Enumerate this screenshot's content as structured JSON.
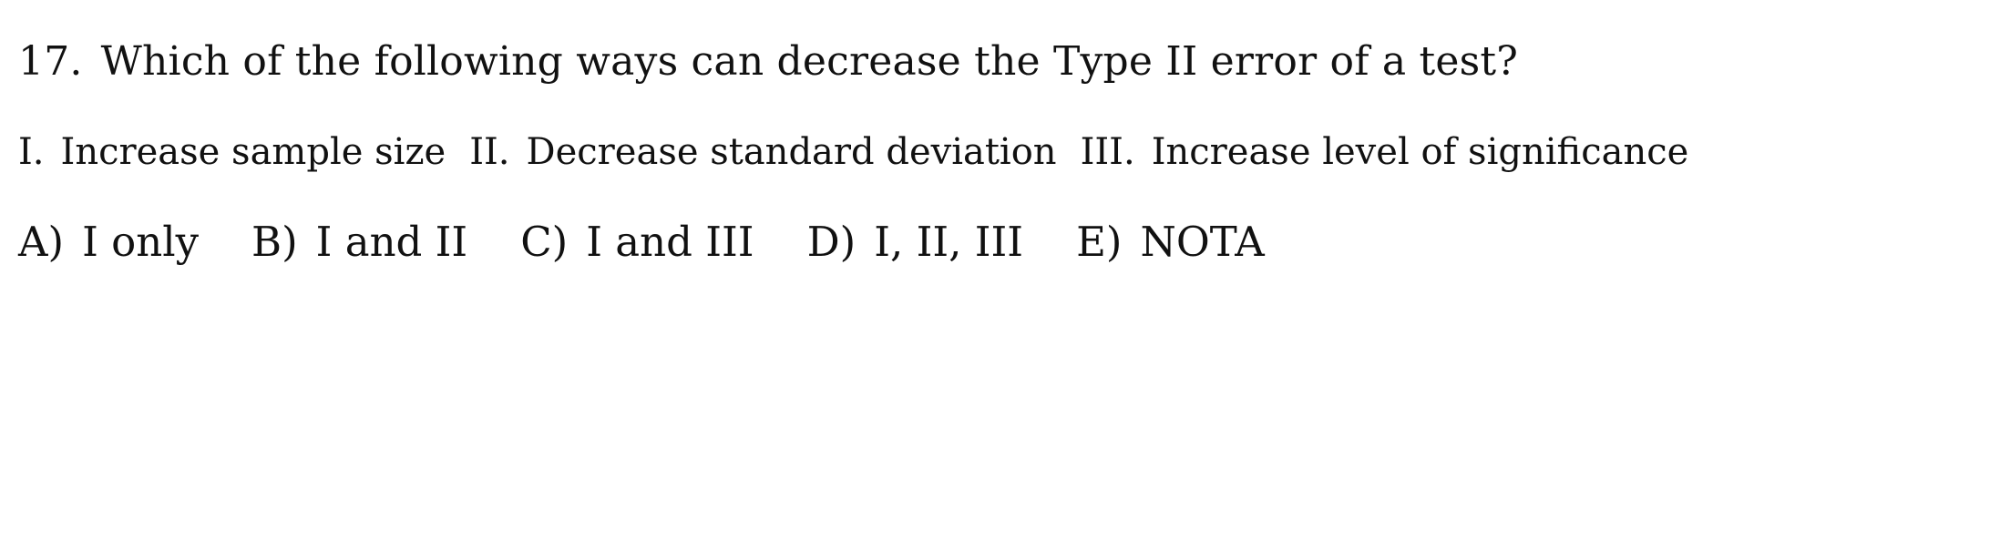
{
  "question": {
    "number": "17.",
    "text": "Which of the following ways can decrease the Type II error of a test?"
  },
  "statements": [
    {
      "numeral": "I.",
      "text": "Increase sample size"
    },
    {
      "numeral": "II.",
      "text": "Decrease standard deviation"
    },
    {
      "numeral": "III.",
      "text": "Increase level of significance"
    }
  ],
  "choices": [
    {
      "letter": "A)",
      "text": "I only"
    },
    {
      "letter": "B)",
      "text": "I and II"
    },
    {
      "letter": "C)",
      "text": "I and III"
    },
    {
      "letter": "D)",
      "text": "I, II, III"
    },
    {
      "letter": "E)",
      "text": "NOTA"
    }
  ]
}
